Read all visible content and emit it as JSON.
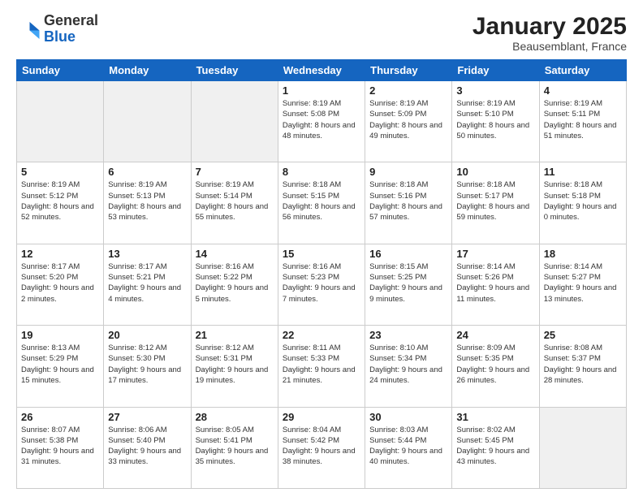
{
  "header": {
    "logo": {
      "general": "General",
      "blue": "Blue"
    },
    "title": "January 2025",
    "subtitle": "Beausemblant, France"
  },
  "weekdays": [
    "Sunday",
    "Monday",
    "Tuesday",
    "Wednesday",
    "Thursday",
    "Friday",
    "Saturday"
  ],
  "weeks": [
    [
      {
        "day": "",
        "empty": true
      },
      {
        "day": "",
        "empty": true
      },
      {
        "day": "",
        "empty": true
      },
      {
        "day": "1",
        "sunrise": "8:19 AM",
        "sunset": "5:08 PM",
        "daylight": "8 hours and 48 minutes."
      },
      {
        "day": "2",
        "sunrise": "8:19 AM",
        "sunset": "5:09 PM",
        "daylight": "8 hours and 49 minutes."
      },
      {
        "day": "3",
        "sunrise": "8:19 AM",
        "sunset": "5:10 PM",
        "daylight": "8 hours and 50 minutes."
      },
      {
        "day": "4",
        "sunrise": "8:19 AM",
        "sunset": "5:11 PM",
        "daylight": "8 hours and 51 minutes."
      }
    ],
    [
      {
        "day": "5",
        "sunrise": "8:19 AM",
        "sunset": "5:12 PM",
        "daylight": "8 hours and 52 minutes."
      },
      {
        "day": "6",
        "sunrise": "8:19 AM",
        "sunset": "5:13 PM",
        "daylight": "8 hours and 53 minutes."
      },
      {
        "day": "7",
        "sunrise": "8:19 AM",
        "sunset": "5:14 PM",
        "daylight": "8 hours and 55 minutes."
      },
      {
        "day": "8",
        "sunrise": "8:18 AM",
        "sunset": "5:15 PM",
        "daylight": "8 hours and 56 minutes."
      },
      {
        "day": "9",
        "sunrise": "8:18 AM",
        "sunset": "5:16 PM",
        "daylight": "8 hours and 57 minutes."
      },
      {
        "day": "10",
        "sunrise": "8:18 AM",
        "sunset": "5:17 PM",
        "daylight": "8 hours and 59 minutes."
      },
      {
        "day": "11",
        "sunrise": "8:18 AM",
        "sunset": "5:18 PM",
        "daylight": "9 hours and 0 minutes."
      }
    ],
    [
      {
        "day": "12",
        "sunrise": "8:17 AM",
        "sunset": "5:20 PM",
        "daylight": "9 hours and 2 minutes."
      },
      {
        "day": "13",
        "sunrise": "8:17 AM",
        "sunset": "5:21 PM",
        "daylight": "9 hours and 4 minutes."
      },
      {
        "day": "14",
        "sunrise": "8:16 AM",
        "sunset": "5:22 PM",
        "daylight": "9 hours and 5 minutes."
      },
      {
        "day": "15",
        "sunrise": "8:16 AM",
        "sunset": "5:23 PM",
        "daylight": "9 hours and 7 minutes."
      },
      {
        "day": "16",
        "sunrise": "8:15 AM",
        "sunset": "5:25 PM",
        "daylight": "9 hours and 9 minutes."
      },
      {
        "day": "17",
        "sunrise": "8:14 AM",
        "sunset": "5:26 PM",
        "daylight": "9 hours and 11 minutes."
      },
      {
        "day": "18",
        "sunrise": "8:14 AM",
        "sunset": "5:27 PM",
        "daylight": "9 hours and 13 minutes."
      }
    ],
    [
      {
        "day": "19",
        "sunrise": "8:13 AM",
        "sunset": "5:29 PM",
        "daylight": "9 hours and 15 minutes."
      },
      {
        "day": "20",
        "sunrise": "8:12 AM",
        "sunset": "5:30 PM",
        "daylight": "9 hours and 17 minutes."
      },
      {
        "day": "21",
        "sunrise": "8:12 AM",
        "sunset": "5:31 PM",
        "daylight": "9 hours and 19 minutes."
      },
      {
        "day": "22",
        "sunrise": "8:11 AM",
        "sunset": "5:33 PM",
        "daylight": "9 hours and 21 minutes."
      },
      {
        "day": "23",
        "sunrise": "8:10 AM",
        "sunset": "5:34 PM",
        "daylight": "9 hours and 24 minutes."
      },
      {
        "day": "24",
        "sunrise": "8:09 AM",
        "sunset": "5:35 PM",
        "daylight": "9 hours and 26 minutes."
      },
      {
        "day": "25",
        "sunrise": "8:08 AM",
        "sunset": "5:37 PM",
        "daylight": "9 hours and 28 minutes."
      }
    ],
    [
      {
        "day": "26",
        "sunrise": "8:07 AM",
        "sunset": "5:38 PM",
        "daylight": "9 hours and 31 minutes."
      },
      {
        "day": "27",
        "sunrise": "8:06 AM",
        "sunset": "5:40 PM",
        "daylight": "9 hours and 33 minutes."
      },
      {
        "day": "28",
        "sunrise": "8:05 AM",
        "sunset": "5:41 PM",
        "daylight": "9 hours and 35 minutes."
      },
      {
        "day": "29",
        "sunrise": "8:04 AM",
        "sunset": "5:42 PM",
        "daylight": "9 hours and 38 minutes."
      },
      {
        "day": "30",
        "sunrise": "8:03 AM",
        "sunset": "5:44 PM",
        "daylight": "9 hours and 40 minutes."
      },
      {
        "day": "31",
        "sunrise": "8:02 AM",
        "sunset": "5:45 PM",
        "daylight": "9 hours and 43 minutes."
      },
      {
        "day": "",
        "empty": true
      }
    ]
  ]
}
